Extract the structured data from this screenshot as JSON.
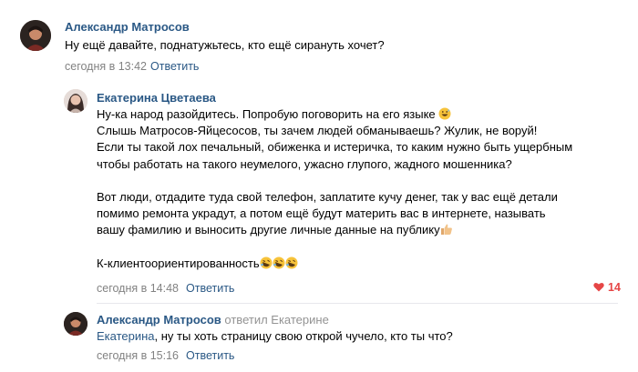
{
  "comments": [
    {
      "author": "Александр Матросов",
      "text": "Ну ещё давайте, поднатужьтесь, кто ещё сирануть хочет?",
      "time": "сегодня в 13:42",
      "reply_label": "Ответить"
    },
    {
      "author": "Екатерина Цветаева",
      "lines": [
        "Ну-ка народ разойдитесь. Попробую поговорить на его языке",
        "Слышь Матросов-Яйцесосов, ты зачем людей обманываешь? Жулик, не воруй!",
        "Если ты такой лох печальный, обиженка и истеричка, то каким нужно быть ущербным",
        "чтобы работать на такого неумелого, ужасно глупого, жадного мошенника?",
        "",
        "Вот люди, отдадите туда свой телефон, заплатите кучу денег, так у вас ещё детали",
        "помимо ремонта украдут, а потом ещё будут материть вас в интернете, называть",
        "вашу фамилию и выносить другие личные данные на публику",
        "",
        "К-клиентоориентированность"
      ],
      "time": "сегодня в 14:48",
      "reply_label": "Ответить",
      "likes": "14",
      "emoji_icons": [
        "grinning-sweat-emoji",
        "thumbs-up-emoji",
        "rofl-emoji"
      ]
    },
    {
      "author": "Александр Матросов",
      "replied_to": "ответил Екатерине",
      "mention": "Екатерина",
      "text": ", ну ты хоть страницу свою открой чучело, кто ты что?",
      "time": "сегодня в 15:16",
      "reply_label": "Ответить"
    }
  ],
  "colors": {
    "link": "#2a5885",
    "meta": "#828282",
    "like": "#e64646",
    "divider": "#e7e8ec"
  }
}
